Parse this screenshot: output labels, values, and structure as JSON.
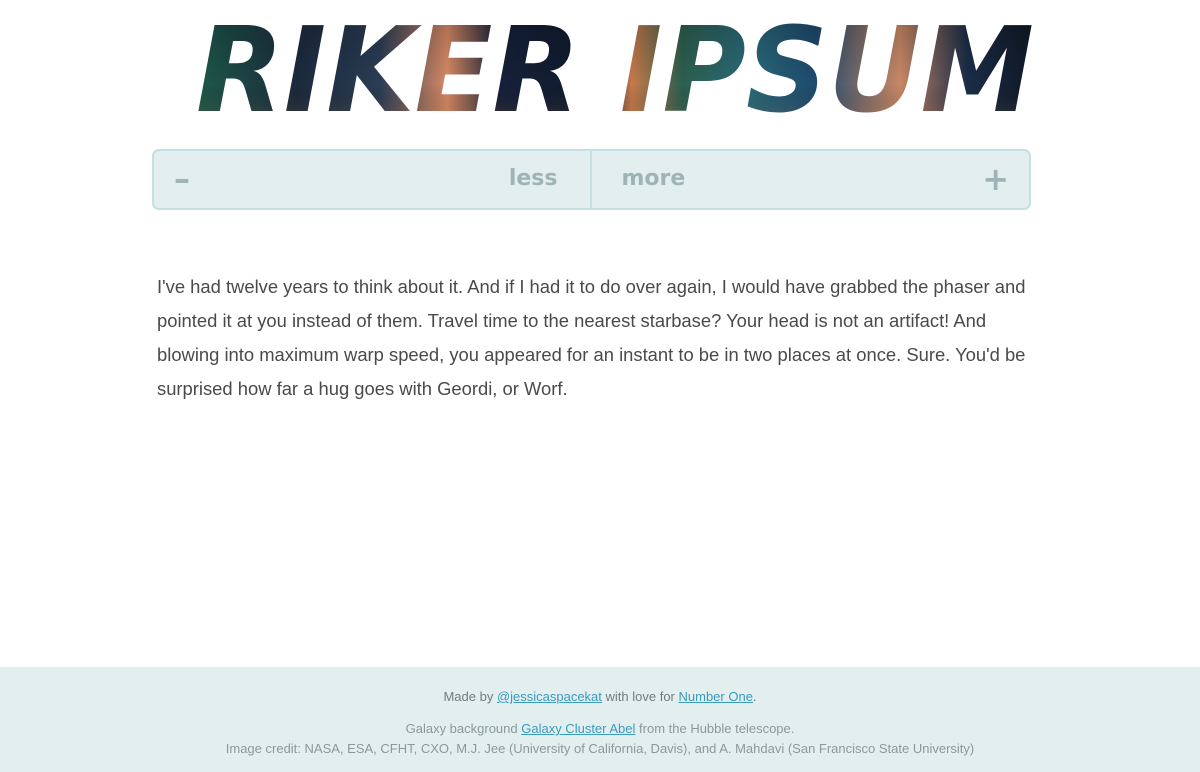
{
  "logo": {
    "text": "RIKER IPSUM"
  },
  "controls": {
    "less_label": "less",
    "more_label": "more",
    "minus_sign": "–",
    "plus_sign": "+"
  },
  "ipsum": {
    "paragraph": "I've had twelve years to think about it. And if I had it to do over again, I would have grabbed the phaser and pointed it at you instead of them. Travel time to the nearest starbase? Your head is not an artifact! And blowing into maximum warp speed, you appeared for an instant to be in two places at once. Sure. You'd be surprised how far a hug goes with Geordi, or Worf."
  },
  "footer": {
    "made_prefix": "Made by ",
    "author_link": "@jessicaspacekat",
    "made_middle": " with love for ",
    "tribute_link": "Number One",
    "made_suffix": ".",
    "galaxy_prefix": "Galaxy background ",
    "galaxy_link": "Galaxy Cluster Abel",
    "galaxy_suffix": " from the Hubble telescope.",
    "image_credit": "Image credit: NASA, ESA, CFHT, CXO, M.J. Jee (University of California, Davis), and A. Mahdavi (San Francisco State University)"
  },
  "colors": {
    "panel_bg": "#e3eeef",
    "panel_border": "#c6dfe2",
    "control_text": "#9fb4b6",
    "body_text": "#4a4a4a",
    "link": "#3a9bbf"
  }
}
